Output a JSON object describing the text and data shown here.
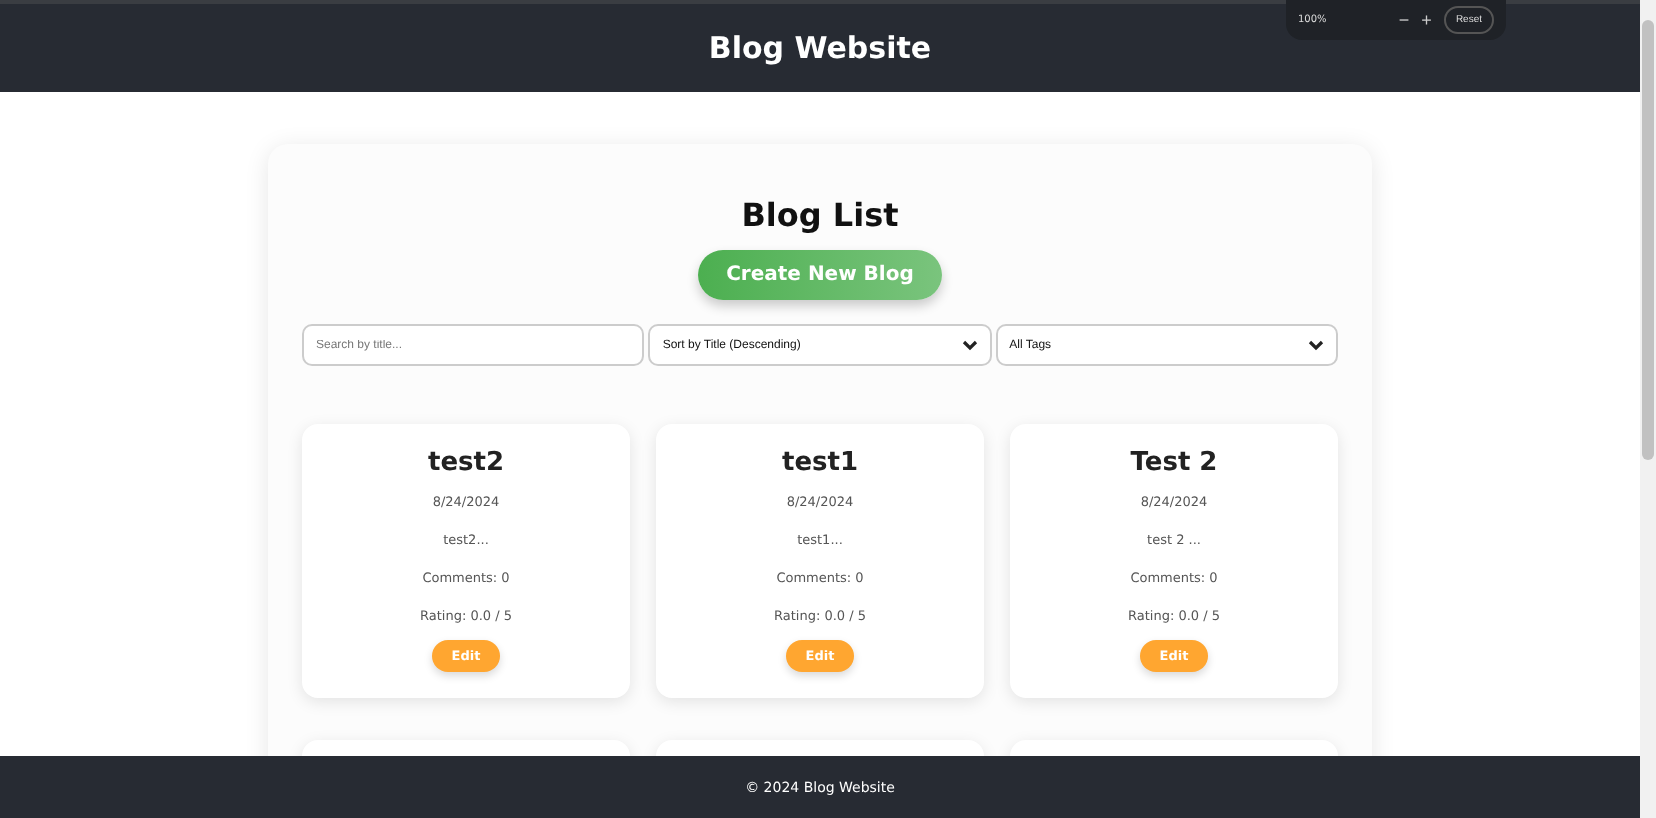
{
  "header": {
    "title": "Blog Website"
  },
  "zoom_widget": {
    "level": "100%",
    "zoom_out": "−",
    "zoom_in": "+",
    "reset": "Reset"
  },
  "page": {
    "title": "Blog List",
    "create_button": "Create New Blog"
  },
  "filters": {
    "search": {
      "placeholder": "Search by title..."
    },
    "sort": {
      "value": "Sort by Title (Descending)"
    },
    "tags": {
      "value": "All Tags"
    }
  },
  "blogs": [
    {
      "title": "test2",
      "date": "8/24/2024",
      "excerpt": "test2...",
      "comments": "Comments: 0",
      "rating": "Rating: 0.0 / 5",
      "edit": "Edit"
    },
    {
      "title": "test1",
      "date": "8/24/2024",
      "excerpt": "test1...",
      "comments": "Comments: 0",
      "rating": "Rating: 0.0 / 5",
      "edit": "Edit"
    },
    {
      "title": "Test 2",
      "date": "8/24/2024",
      "excerpt": "test 2 ...",
      "comments": "Comments: 0",
      "rating": "Rating: 0.0 / 5",
      "edit": "Edit"
    }
  ],
  "footer": {
    "text": "© 2024 Blog Website"
  }
}
